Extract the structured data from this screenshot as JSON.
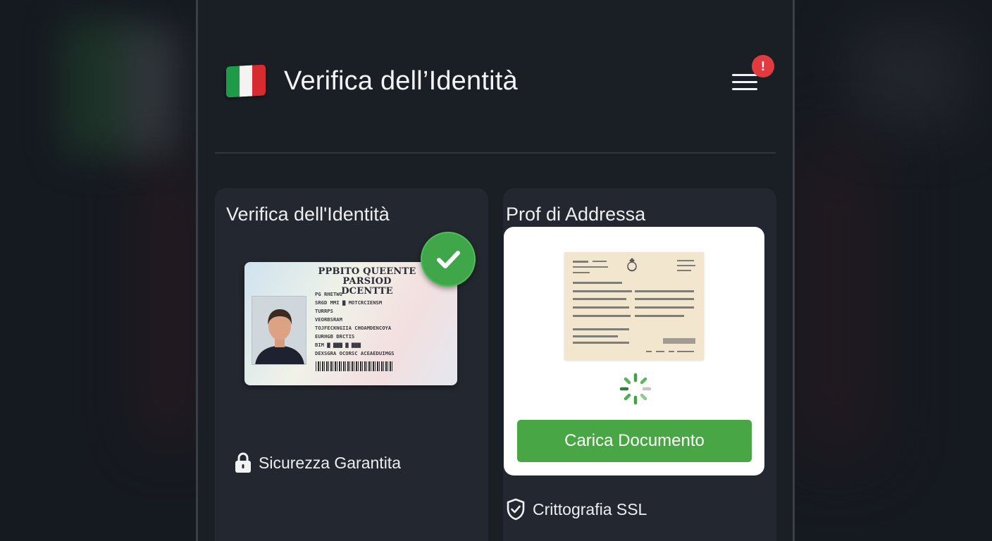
{
  "app": {
    "title": "Verifica dell’Identità",
    "notification_count": "!"
  },
  "identity_card": {
    "title": "Verifica dell'Identità",
    "status": "verified",
    "document": {
      "header_line1": "PPBITO QUEENTE",
      "header_line2": "PARSIOD DCENTTE",
      "rows": [
        "PG RHETWO",
        "SRGD MMI ▇    MOTCRCIENSM",
        "TURRPS",
        "VEORBSRAM",
        "TOJFECKNGIIA    CHOAMDENCOYA",
        "EURHGB        BRCTIS",
        "BIM ▇    ▇▇▇ ▇ ▇▇▇",
        "DEXSGRA   OCORSC    ACEAEDUIMGS"
      ]
    },
    "security_text": "Sicurezza Garantita"
  },
  "address_card": {
    "title": "Prof di Addressa",
    "upload_button": "Carica Documento",
    "ssl_text": "Crittografia SSL"
  },
  "colors": {
    "background": "#151920",
    "panel": "#1a1e25",
    "card": "#23272f",
    "accent_green": "#48a744",
    "badge_red": "#e13b3f"
  },
  "icons": {
    "flag": "italian-flag-icon",
    "menu": "hamburger-menu-icon",
    "verified": "check-circle-icon",
    "lock": "lock-icon",
    "shield": "shield-check-icon",
    "loading": "spinner-icon"
  }
}
